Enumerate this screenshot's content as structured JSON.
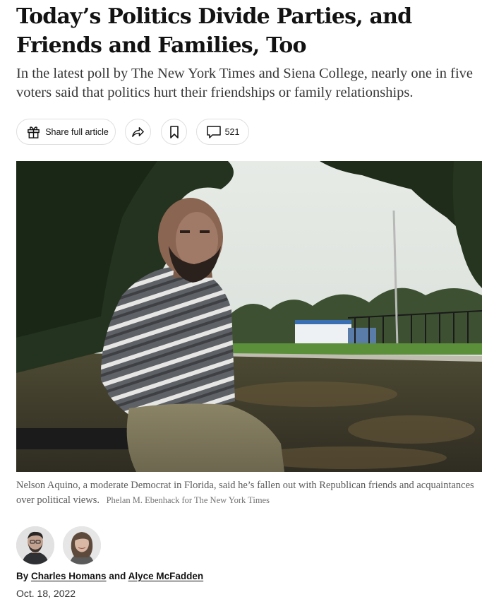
{
  "article": {
    "headline": "Today’s Politics Divide Parties, and Friends and Families, Too",
    "summary": "In the latest poll by The New York Times and Siena College, nearly one in five voters said that politics hurt their friendships or family relationships."
  },
  "toolbar": {
    "share_full_label": "Share full article",
    "comment_count": "521"
  },
  "photo": {
    "caption": "Nelson Aquino, a moderate Democrat in Florida, said he’s fallen out with Republican friends and acquaintances over political views.",
    "credit": "Phelan M. Ebenhack for The New York Times"
  },
  "byline": {
    "prefix": "By",
    "author1": "Charles Homans",
    "joiner": "and",
    "author2": "Alyce McFadden"
  },
  "date": "Oct. 18, 2022",
  "icons": {
    "gift": "gift-icon",
    "share": "share-arrow-icon",
    "bookmark": "bookmark-icon",
    "comment": "comment-bubble-icon"
  }
}
